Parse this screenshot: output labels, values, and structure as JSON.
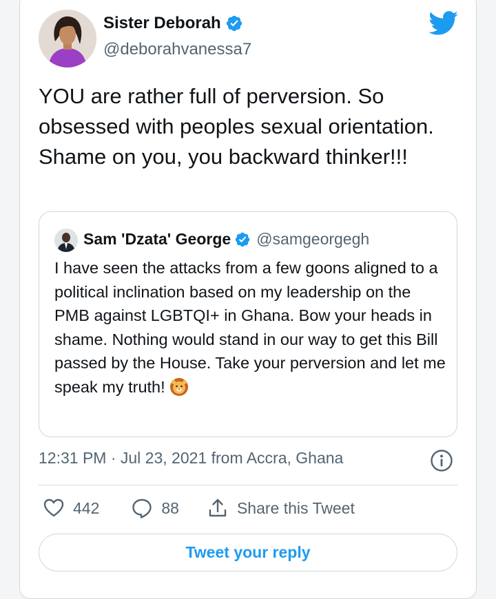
{
  "tweet": {
    "author_name": "Sister Deborah",
    "author_handle": "@deborahvanessa7",
    "text": "YOU are rather full of perversion. So obsessed with peoples sexual orientation. Shame on you, you backward thinker!!!",
    "timestamp": "12:31 PM · Jul 23, 2021 from Accra, Ghana"
  },
  "quoted_tweet": {
    "author_name": "Sam 'Dzata' George",
    "author_handle": "@samgeorgegh",
    "text": "I have seen the attacks from a few goons aligned to a political inclination based on my leadership on the PMB against LGBTQI+ in Ghana. Bow your heads in shame. Nothing would stand in our way to get this Bill passed by the House. Take your perversion and let me speak my truth!",
    "emoji_icon": "lion-face-icon"
  },
  "actions": {
    "likes": "442",
    "replies": "88",
    "share_label": "Share this Tweet",
    "reply_button_label": "Tweet your reply"
  },
  "colors": {
    "twitter_blue": "#1d9bf0",
    "text_primary": "#0f1419",
    "text_secondary": "#536471",
    "border": "#cfd9de"
  }
}
